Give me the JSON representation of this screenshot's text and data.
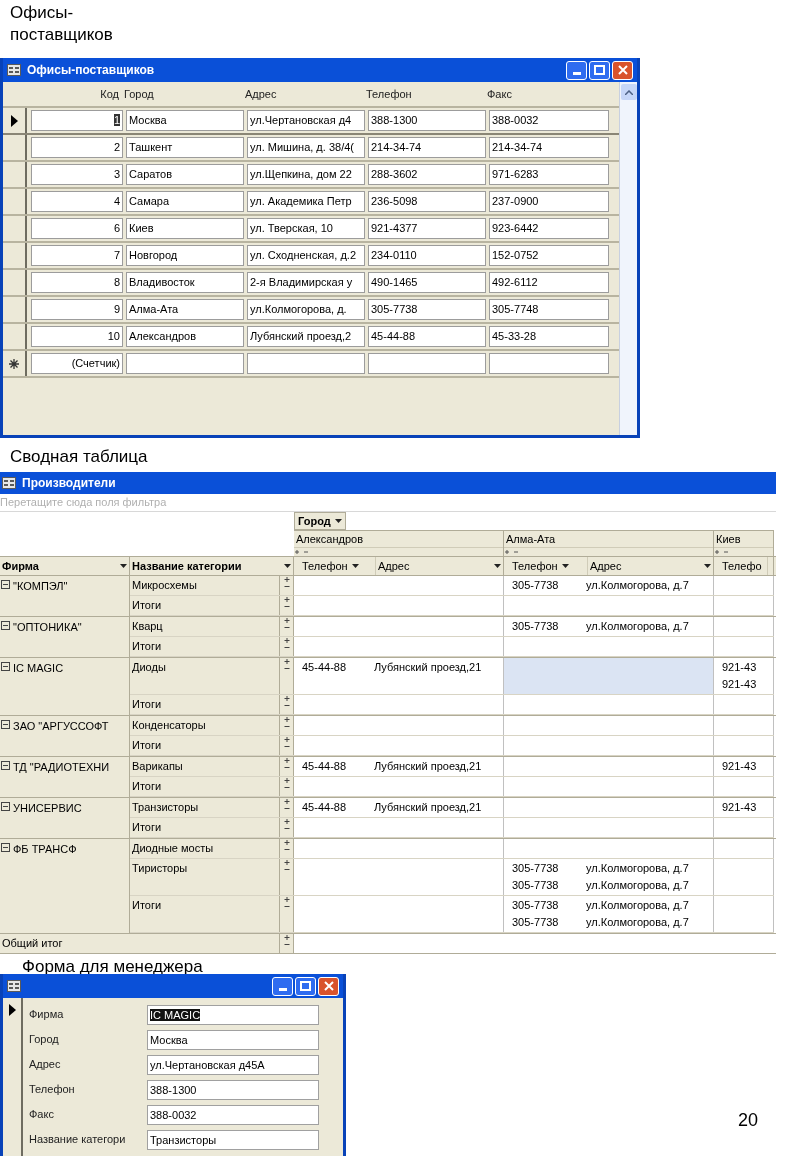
{
  "slide": {
    "captions": [
      "Офисы-поставщиков",
      "Сводная таблица",
      "Форма для менеджера"
    ],
    "page_number": "20"
  },
  "offices_window": {
    "title": "Офисы-поставщиков",
    "columns": [
      "Код",
      "Город",
      "Адрес",
      "Телефон",
      "Факс"
    ],
    "rows": [
      {
        "kind": "record",
        "selected": true,
        "cells": [
          "1",
          "Москва",
          "ул.Чертановская д4",
          "388-1300",
          "388-0032"
        ]
      },
      {
        "kind": "record",
        "selected": false,
        "cells": [
          "2",
          "Ташкент",
          "ул. Мишина, д. 38/4(",
          "214-34-74",
          "214-34-74"
        ]
      },
      {
        "kind": "record",
        "selected": false,
        "cells": [
          "3",
          "Саратов",
          "ул.Щепкина, дом 22",
          "288-3602",
          "971-6283"
        ]
      },
      {
        "kind": "record",
        "selected": false,
        "cells": [
          "4",
          "Самара",
          "ул. Академика Петр",
          "236-5098",
          "237-0900"
        ]
      },
      {
        "kind": "record",
        "selected": false,
        "cells": [
          "6",
          "Киев",
          "ул. Тверская, 10",
          "921-4377",
          "923-6442"
        ]
      },
      {
        "kind": "record",
        "selected": false,
        "cells": [
          "7",
          "Новгород",
          "ул. Сходненская, д.2",
          "234-0110",
          "152-0752"
        ]
      },
      {
        "kind": "record",
        "selected": false,
        "cells": [
          "8",
          "Владивосток",
          "2-я Владимирская у",
          "490-1465",
          "492-6112"
        ]
      },
      {
        "kind": "record",
        "selected": false,
        "cells": [
          "9",
          "Алма-Ата",
          "ул.Колмогорова, д.",
          "305-7738",
          "305-7748"
        ]
      },
      {
        "kind": "record",
        "selected": false,
        "cells": [
          "10",
          "Александров",
          "Лубянский проезд,2",
          "45-44-88",
          "45-33-28"
        ]
      },
      {
        "kind": "new",
        "cells": [
          "(Счетчик)"
        ]
      }
    ]
  },
  "pivot_window": {
    "title": "Производители",
    "filter_hint": "Перетащите сюда поля фильтра",
    "column_field": "Город",
    "cities": [
      {
        "name": "Александров",
        "fields": [
          "Телефон",
          "Адрес"
        ]
      },
      {
        "name": "Алма-Ата",
        "fields": [
          "Телефон",
          "Адрес"
        ]
      },
      {
        "name": "Киев",
        "fields": [
          "Телефо"
        ]
      }
    ],
    "row_fields": [
      "Фирма",
      "Название категории"
    ],
    "groups": [
      {
        "firm": "\"КОМПЭЛ\"",
        "rows": [
          {
            "category": "Микросхемы",
            "cells": [
              {
                "selected": false
              },
              {
                "selected": false,
                "lines": [
                  {
                    "phone": "305-7738",
                    "address": "ул.Колмогорова, д.7"
                  }
                ]
              },
              {
                "selected": false
              }
            ]
          },
          {
            "category": "Итоги",
            "cells": [
              {
                "selected": false
              },
              {
                "selected": false
              },
              {
                "selected": false
              }
            ]
          }
        ]
      },
      {
        "firm": "\"ОПТОНИКА\"",
        "rows": [
          {
            "category": "Кварц",
            "cells": [
              {
                "selected": false
              },
              {
                "selected": false,
                "lines": [
                  {
                    "phone": "305-7738",
                    "address": "ул.Колмогорова, д.7"
                  }
                ]
              },
              {
                "selected": false
              }
            ]
          },
          {
            "category": "Итоги",
            "cells": [
              {
                "selected": false
              },
              {
                "selected": false
              },
              {
                "selected": false
              }
            ]
          }
        ]
      },
      {
        "firm": "IC MAGIC",
        "rows": [
          {
            "category": "Диоды",
            "cells": [
              {
                "selected": false,
                "lines": [
                  {
                    "phone": "45-44-88",
                    "address": "Лубянский проезд,21"
                  }
                ]
              },
              {
                "selected": true
              },
              {
                "selected": false,
                "lines": [
                  {
                    "phone": "921-43"
                  },
                  {
                    "phone": "921-43"
                  }
                ]
              }
            ]
          },
          {
            "category": "Итоги",
            "cells": [
              {
                "selected": false
              },
              {
                "selected": false
              },
              {
                "selected": false
              }
            ]
          }
        ]
      },
      {
        "firm": "ЗАО \"АРГУССОФТ",
        "rows": [
          {
            "category": "Конденсаторы",
            "cells": [
              {
                "selected": false
              },
              {
                "selected": false
              },
              {
                "selected": false
              }
            ]
          },
          {
            "category": "Итоги",
            "cells": [
              {
                "selected": false
              },
              {
                "selected": false
              },
              {
                "selected": false
              }
            ]
          }
        ]
      },
      {
        "firm": "ТД \"РАДИОТЕХНИ",
        "rows": [
          {
            "category": "Варикапы",
            "cells": [
              {
                "selected": false,
                "lines": [
                  {
                    "phone": "45-44-88",
                    "address": "Лубянский проезд,21"
                  }
                ]
              },
              {
                "selected": false
              },
              {
                "selected": false,
                "lines": [
                  {
                    "phone": "921-43"
                  }
                ]
              }
            ]
          },
          {
            "category": "Итоги",
            "cells": [
              {
                "selected": false
              },
              {
                "selected": false
              },
              {
                "selected": false
              }
            ]
          }
        ]
      },
      {
        "firm": "УНИСЕРВИС",
        "rows": [
          {
            "category": "Транзисторы",
            "cells": [
              {
                "selected": false,
                "lines": [
                  {
                    "phone": "45-44-88",
                    "address": "Лубянский проезд,21"
                  }
                ]
              },
              {
                "selected": false
              },
              {
                "selected": false,
                "lines": [
                  {
                    "phone": "921-43"
                  }
                ]
              }
            ]
          },
          {
            "category": "Итоги",
            "cells": [
              {
                "selected": false
              },
              {
                "selected": false
              },
              {
                "selected": false
              }
            ]
          }
        ]
      },
      {
        "firm": "ФБ ТРАНСФ",
        "rows": [
          {
            "category": "Диодные мосты",
            "cells": [
              {
                "selected": false
              },
              {
                "selected": false
              },
              {
                "selected": false
              }
            ]
          },
          {
            "category": "Тиристоры",
            "cells": [
              {
                "selected": false
              },
              {
                "selected": false,
                "lines": [
                  {
                    "phone": "305-7738",
                    "address": "ул.Колмогорова, д.7"
                  },
                  {
                    "phone": "305-7738",
                    "address": "ул.Колмогорова, д.7"
                  }
                ]
              },
              {
                "selected": false
              }
            ]
          },
          {
            "category": "Итоги",
            "cells": [
              {
                "selected": false
              },
              {
                "selected": false,
                "lines": [
                  {
                    "phone": "305-7738",
                    "address": "ул.Колмогорова, д.7"
                  },
                  {
                    "phone": "305-7738",
                    "address": "ул.Колмогорова, д.7"
                  }
                ]
              },
              {
                "selected": false
              }
            ]
          }
        ]
      }
    ],
    "grand_total": "Общий итог"
  },
  "manager_form": {
    "fields": [
      {
        "label": "Фирма",
        "value": "IC MAGIC",
        "selected": true
      },
      {
        "label": "Город",
        "value": "Москва",
        "selected": false
      },
      {
        "label": "Адрес",
        "value": "ул.Чертановская д45А",
        "selected": false
      },
      {
        "label": "Телефон",
        "value": "388-1300",
        "selected": false
      },
      {
        "label": "Факс",
        "value": "388-0032",
        "selected": false
      },
      {
        "label": "Название категори",
        "value": "Транзисторы",
        "selected": false
      }
    ]
  }
}
